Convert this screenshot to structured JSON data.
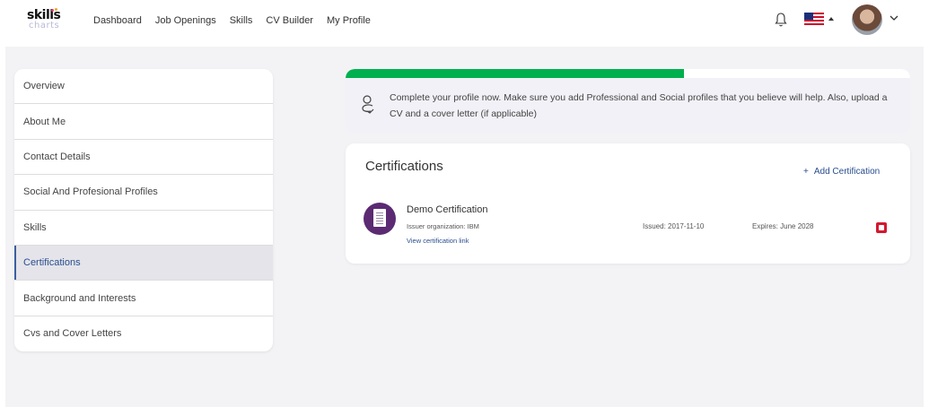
{
  "brand": {
    "logo_top": "skills",
    "logo_bottom": "charts"
  },
  "nav": {
    "items": [
      {
        "label": "Dashboard"
      },
      {
        "label": "Job Openings"
      },
      {
        "label": "Skills"
      },
      {
        "label": "CV Builder"
      },
      {
        "label": "My Profile"
      }
    ]
  },
  "header_icons": [
    "bell-icon",
    "us-flag-icon",
    "caret-up-icon",
    "avatar",
    "chevron-down-icon"
  ],
  "sidebar": {
    "items": [
      {
        "label": "Overview",
        "active": false
      },
      {
        "label": "About Me",
        "active": false
      },
      {
        "label": "Contact Details",
        "active": false
      },
      {
        "label": "Social And Profesional Profiles",
        "active": false
      },
      {
        "label": "Skills",
        "active": false
      },
      {
        "label": "Certifications",
        "active": true
      },
      {
        "label": "Background and Interests",
        "active": false
      },
      {
        "label": "Cvs and Cover Letters",
        "active": false
      }
    ]
  },
  "profile_completion": {
    "progress_fraction": 0.6,
    "color": "#00b04f",
    "message": "Complete your profile now. Make sure you add Professional and Social profiles that you believe will help. Also, upload a CV and a cover letter (if applicable)"
  },
  "certifications": {
    "title": "Certifications",
    "add_label": "Add Certification",
    "add_icon": "+",
    "items": [
      {
        "name": "Demo Certification",
        "issuer": "Issuer organization: IBM",
        "link_label": "View certification link",
        "issued": "Issued: 2017-11-10",
        "expires": "Expires: June 2028"
      }
    ]
  },
  "colors": {
    "accent": "#2a4d8f",
    "progress": "#00b04f",
    "delete": "#d4182f",
    "badge": "#5b2a73"
  }
}
